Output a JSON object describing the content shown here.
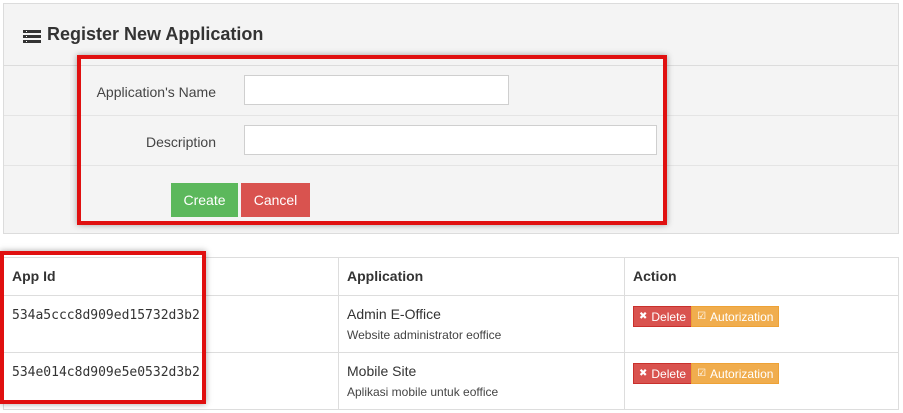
{
  "form": {
    "title": "Register New Application",
    "name_label": "Application's Name",
    "name_value": "",
    "description_label": "Description",
    "description_value": "",
    "create_label": "Create",
    "cancel_label": "Cancel"
  },
  "table": {
    "headers": [
      "App Id",
      "Application",
      "Action"
    ],
    "rows": [
      {
        "app_id": "534a5ccc8d909ed15732d3b2",
        "name": "Admin E-Office",
        "description": "Website administrator eoffice",
        "delete_label": "Delete",
        "auth_label": "Autorization"
      },
      {
        "app_id": "534e014c8d909e5e0532d3b2",
        "name": "Mobile Site",
        "description": "Aplikasi mobile untuk eoffice",
        "delete_label": "Delete",
        "auth_label": "Autorization"
      }
    ]
  },
  "colors": {
    "create": "#5cb85c",
    "cancel": "#d9534f",
    "delete": "#d9534f",
    "authorize": "#f0ad4e",
    "highlight": "#e01010"
  },
  "icons": {
    "title": "list-icon",
    "delete": "times-icon",
    "authorize": "check-square-icon"
  }
}
